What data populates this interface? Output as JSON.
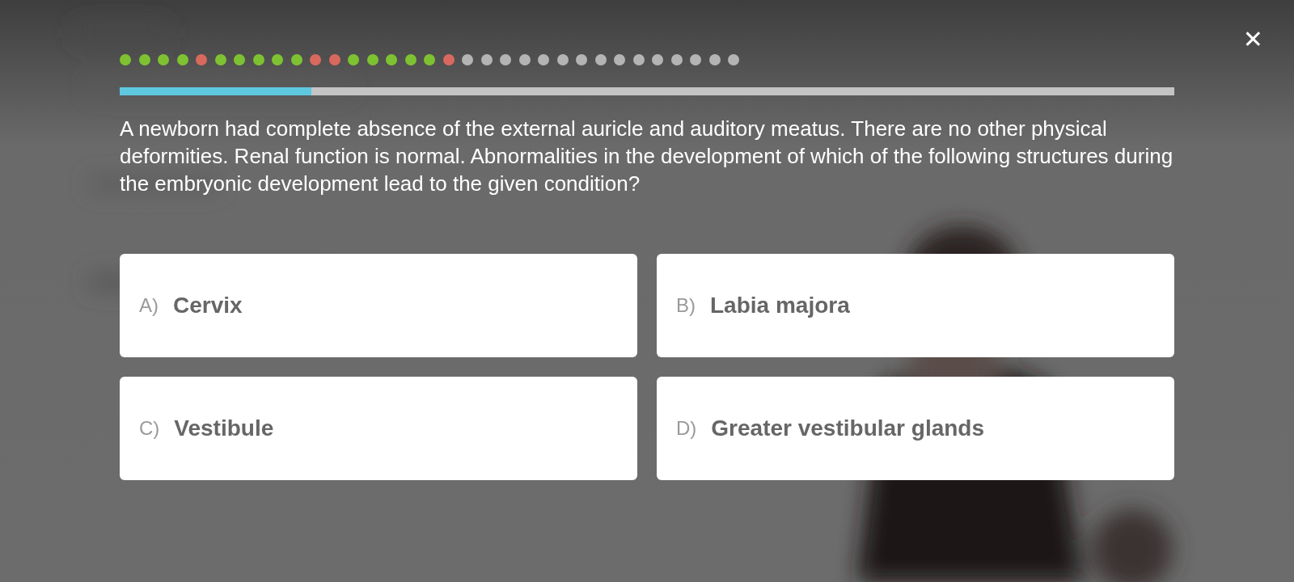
{
  "progress_dots": [
    {
      "color": "#7ec232"
    },
    {
      "color": "#7ec232"
    },
    {
      "color": "#7ec232"
    },
    {
      "color": "#7ec232"
    },
    {
      "color": "#d9695e"
    },
    {
      "color": "#7ec232"
    },
    {
      "color": "#7ec232"
    },
    {
      "color": "#7ec232"
    },
    {
      "color": "#7ec232"
    },
    {
      "color": "#7ec232"
    },
    {
      "color": "#d9695e"
    },
    {
      "color": "#d9695e"
    },
    {
      "color": "#7ec232"
    },
    {
      "color": "#7ec232"
    },
    {
      "color": "#7ec232"
    },
    {
      "color": "#7ec232"
    },
    {
      "color": "#7ec232"
    },
    {
      "color": "#d9695e"
    },
    {
      "color": "#b4b4b4"
    },
    {
      "color": "#b4b4b4"
    },
    {
      "color": "#b4b4b4"
    },
    {
      "color": "#b4b4b4"
    },
    {
      "color": "#b4b4b4"
    },
    {
      "color": "#b4b4b4"
    },
    {
      "color": "#b4b4b4"
    },
    {
      "color": "#b4b4b4"
    },
    {
      "color": "#b4b4b4"
    },
    {
      "color": "#b4b4b4"
    },
    {
      "color": "#b4b4b4"
    },
    {
      "color": "#b4b4b4"
    },
    {
      "color": "#b4b4b4"
    },
    {
      "color": "#b4b4b4"
    },
    {
      "color": "#b4b4b4"
    }
  ],
  "progress_bar": {
    "level": 0.182
  },
  "close_button": {
    "label": "✕"
  },
  "question": "A newborn had complete absence of the external auricle and auditory meatus. There are no other physical deformities. Renal function is normal. Abnormalities in the development of which of the following structures during the embryonic development lead to the given condition?",
  "options": [
    {
      "letter": "A)",
      "text": "Cervix"
    },
    {
      "letter": "B)",
      "text": "Labia majora"
    },
    {
      "letter": "C)",
      "text": "Vestibule"
    },
    {
      "letter": "D)",
      "text": "Greater vestibular glands"
    }
  ]
}
